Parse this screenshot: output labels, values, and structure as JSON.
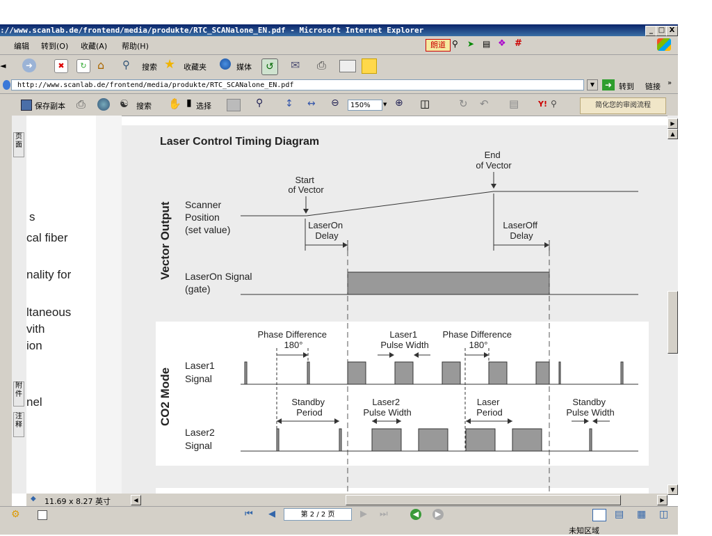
{
  "window": {
    "title": "://www.scanlab.de/frontend/media/produkte/RTC_SCANalone_EN.pdf - Microsoft Internet Explorer",
    "controls": [
      "_",
      "□",
      "X"
    ]
  },
  "menu": [
    "编辑",
    "转到(O)",
    "收藏(A)",
    "帮助(H)"
  ],
  "menu_right_badge": "朗道",
  "toolbar": {
    "search": "搜索",
    "favorites": "收藏夹",
    "media": "媒体"
  },
  "address": {
    "url": "http://www.scanlab.de/frontend/media/produkte/RTC_SCANalone_EN.pdf",
    "go": "转到",
    "links": "链接"
  },
  "acrobat": {
    "save_copy": "保存副本",
    "search": "搜索",
    "select": "选择",
    "zoom": "150%",
    "review": "简化您的审阅流程"
  },
  "side_tabs": [
    "页面",
    "附件",
    "注释"
  ],
  "prev_page_fragments": [
    "s",
    "cal fiber",
    "nality for",
    "ltaneous",
    "vith",
    "ion",
    "nel"
  ],
  "page_size": "11.69 x 8.27 英寸",
  "page_nav": "第 2 / 2 页",
  "status": "未知区域",
  "diagram": {
    "title": "Laser Control Timing Diagram",
    "section_vector": "Vector Output",
    "section_co2": "CO2 Mode",
    "start_of_vector": [
      "Start",
      "of Vector"
    ],
    "end_of_vector": [
      "End",
      "of Vector"
    ],
    "scanner_position": [
      "Scanner",
      "Position",
      "(set value)"
    ],
    "laseron_delay": [
      "LaserOn",
      "Delay"
    ],
    "laseroff_delay": [
      "LaserOff",
      "Delay"
    ],
    "laseron_signal": [
      "LaserOn Signal",
      "(gate)"
    ],
    "phase_diff_1": [
      "Phase Difference",
      "180°"
    ],
    "laser1_pulse_width": [
      "Laser1",
      "Pulse Width"
    ],
    "phase_diff_2": [
      "Phase Difference",
      "180°"
    ],
    "laser1_signal": [
      "Laser1",
      "Signal"
    ],
    "standby_period": [
      "Standby",
      "Period"
    ],
    "laser2_pulse_width": [
      "Laser2",
      "Pulse Width"
    ],
    "laser_period": [
      "Laser",
      "Period"
    ],
    "standby_pulse_width": [
      "Standby",
      "Pulse Width"
    ],
    "laser2_signal": [
      "Laser2",
      "Signal"
    ]
  }
}
